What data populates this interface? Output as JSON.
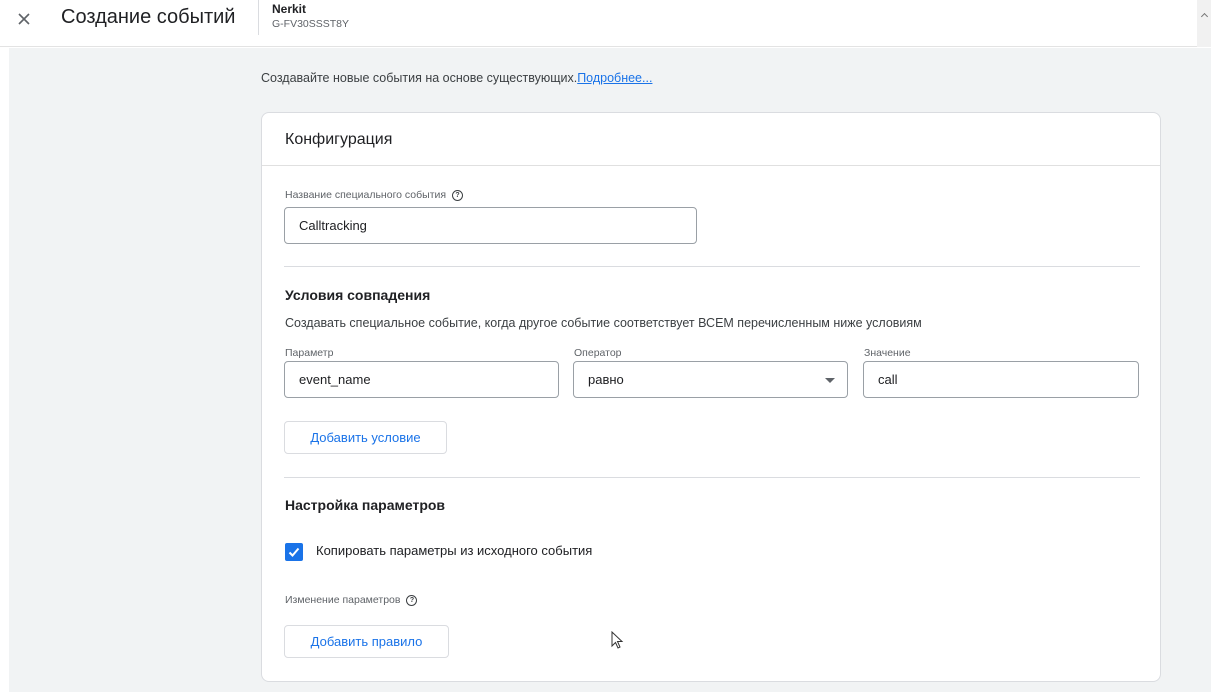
{
  "header": {
    "title": "Создание событий",
    "property_name": "Nerkit",
    "property_id": "G-FV30SSST8Y"
  },
  "intro": {
    "text": "Создавайте новые события на основе существующих.",
    "link": "Подробнее..."
  },
  "config": {
    "title": "Конфигурация",
    "event_name_label": "Название специального события",
    "event_name_value": "Calltracking"
  },
  "match": {
    "title": "Условия совпадения",
    "description": "Создавать специальное событие, когда другое событие соответствует ВСЕМ перечисленным ниже условиям",
    "param_label": "Параметр",
    "param_value": "event_name",
    "operator_label": "Оператор",
    "operator_value": "равно",
    "value_label": "Значение",
    "value_value": "call",
    "add_condition": "Добавить условие"
  },
  "params": {
    "title": "Настройка параметров",
    "copy_label": "Копировать параметры из исходного события",
    "copy_checked": true,
    "modify_label": "Изменение параметров",
    "add_rule": "Добавить правило"
  },
  "colors": {
    "accent": "#1a73e8",
    "background": "#f1f3f4"
  }
}
